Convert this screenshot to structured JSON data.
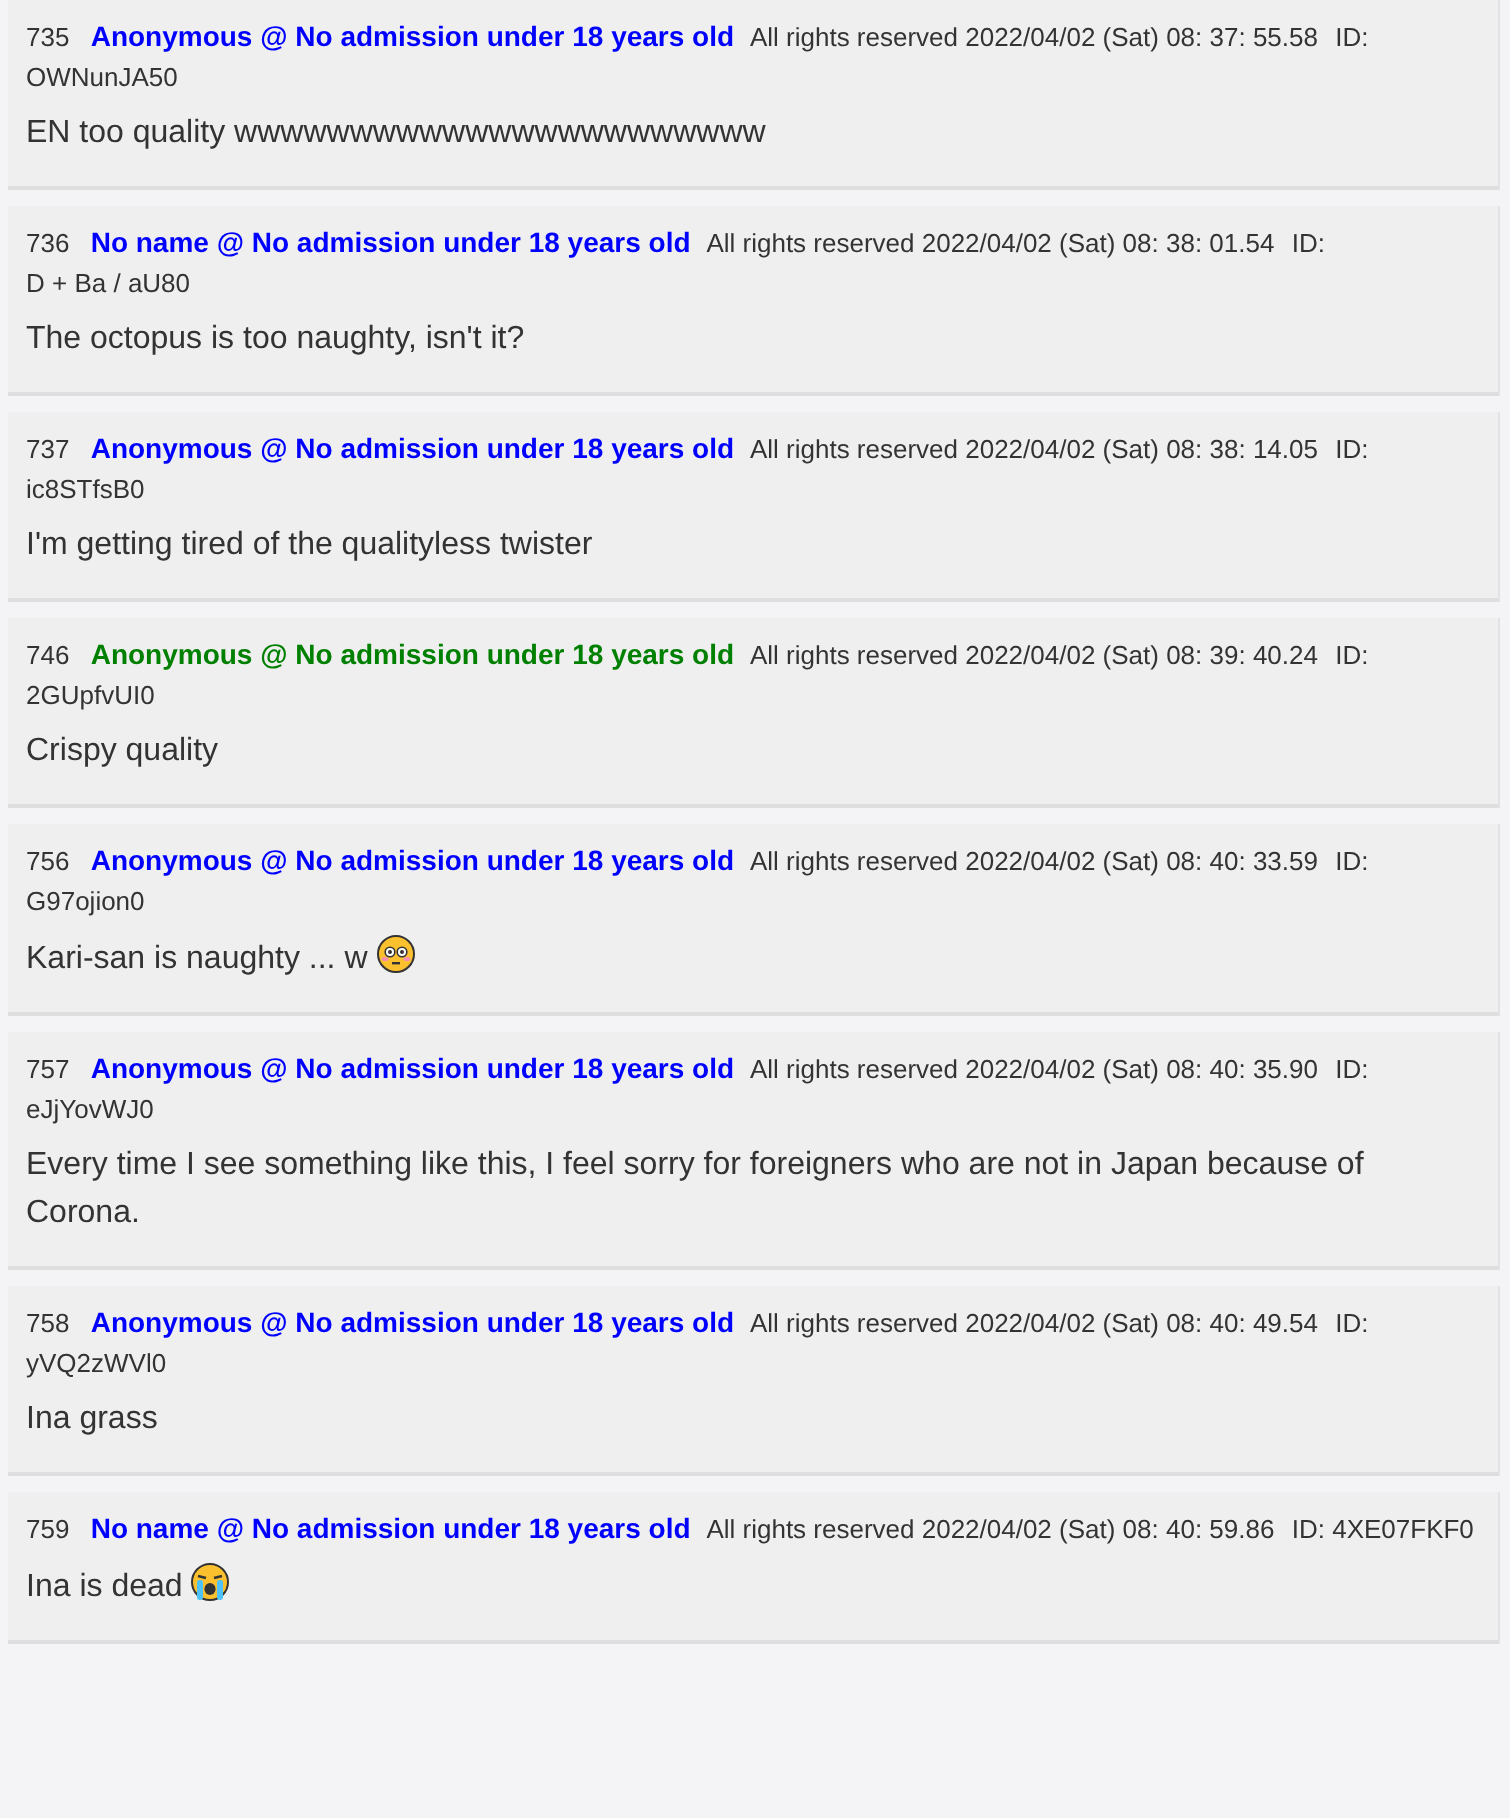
{
  "posts": [
    {
      "kind": "plain",
      "number": "735",
      "name": "Anonymous @ No admission under 18 years old",
      "color": "#0000ff",
      "meta": "All rights reserved 2022/04/02 (Sat) 08: 37: 55.58",
      "id_label": "ID:",
      "id": "OWNunJA50",
      "body": "EN too quality wwwwwwwwwwwwwwwwwwwwwww"
    },
    {
      "kind": "plain",
      "number": "736",
      "name": "No name @ No admission under 18 years old",
      "color": "#0000ff",
      "meta": "All rights reserved 2022/04/02 (Sat) 08: 38: 01.54",
      "id_label": "ID:",
      "id": "D + Ba / aU80",
      "body": "The octopus is too naughty, isn't it?"
    },
    {
      "kind": "plain",
      "number": "737",
      "name": "Anonymous @ No admission under 18 years old",
      "color": "#0000ff",
      "meta": "All rights reserved 2022/04/02 (Sat) 08: 38: 14.05",
      "id_label": "ID:",
      "id": "ic8STfsB0",
      "body": "I'm getting tired of the qualityless twister"
    },
    {
      "kind": "plain",
      "number": "746",
      "name": "Anonymous @ No admission under 18 years old",
      "color": "#008000",
      "meta": "All rights reserved 2022/04/02 (Sat) 08: 39: 40.24",
      "id_label": "ID:",
      "id": "2GUpfvUI0",
      "body": "Crispy quality"
    },
    {
      "kind": "flushed",
      "number": "756",
      "name": "Anonymous @ No admission under 18 years old",
      "color": "#0000ff",
      "meta": "All rights reserved 2022/04/02 (Sat) 08: 40: 33.59",
      "id_label": "ID:",
      "id": "G97ojion0",
      "body": "Kari-san is naughty ... w"
    },
    {
      "kind": "plain",
      "number": "757",
      "name": "Anonymous @ No admission under 18 years old",
      "color": "#0000ff",
      "meta": "All rights reserved 2022/04/02 (Sat) 08: 40: 35.90",
      "id_label": "ID:",
      "id": "eJjYovWJ0",
      "body": "Every time I see something like this, I feel sorry for foreigners who are not in Japan because of Corona."
    },
    {
      "kind": "plain",
      "number": "758",
      "name": "Anonymous @ No admission under 18 years old",
      "color": "#0000ff",
      "meta": "All rights reserved 2022/04/02 (Sat) 08: 40: 49.54",
      "id_label": "ID:",
      "id": "yVQ2zWVl0",
      "body": "Ina grass"
    },
    {
      "kind": "crying",
      "number": "759",
      "name": "No name @ No admission under 18 years old",
      "color": "#0000ff",
      "meta": "All rights reserved 2022/04/02 (Sat) 08: 40: 59.86",
      "id_label": "ID:",
      "id": "4XE07FKF0",
      "body": "Ina is dead"
    }
  ]
}
